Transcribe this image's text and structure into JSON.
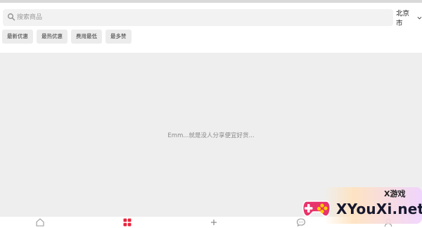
{
  "search": {
    "placeholder": "搜索商品",
    "value": ""
  },
  "location": {
    "city": "北京市"
  },
  "filters": [
    {
      "label": "最新优惠"
    },
    {
      "label": "最热优惠"
    },
    {
      "label": "费用最低"
    },
    {
      "label": "最多赞"
    }
  ],
  "empty_state": {
    "message": "Emm...就是没人分享便宜好货..."
  },
  "tabbar": {
    "active_tab": "category",
    "accent_color": "#e8243c",
    "inactive_color": "#9a9a9a",
    "icons": [
      "home-icon",
      "grid-icon",
      "plus-icon",
      "chat-bubble-icon",
      "user-icon"
    ]
  },
  "watermark": {
    "cn": "X游戏",
    "brand": "XYouXi.net"
  },
  "colors": {
    "content_bg": "#eeeeee",
    "chip_bg": "#ececec",
    "search_bg": "#f2f2f2"
  }
}
